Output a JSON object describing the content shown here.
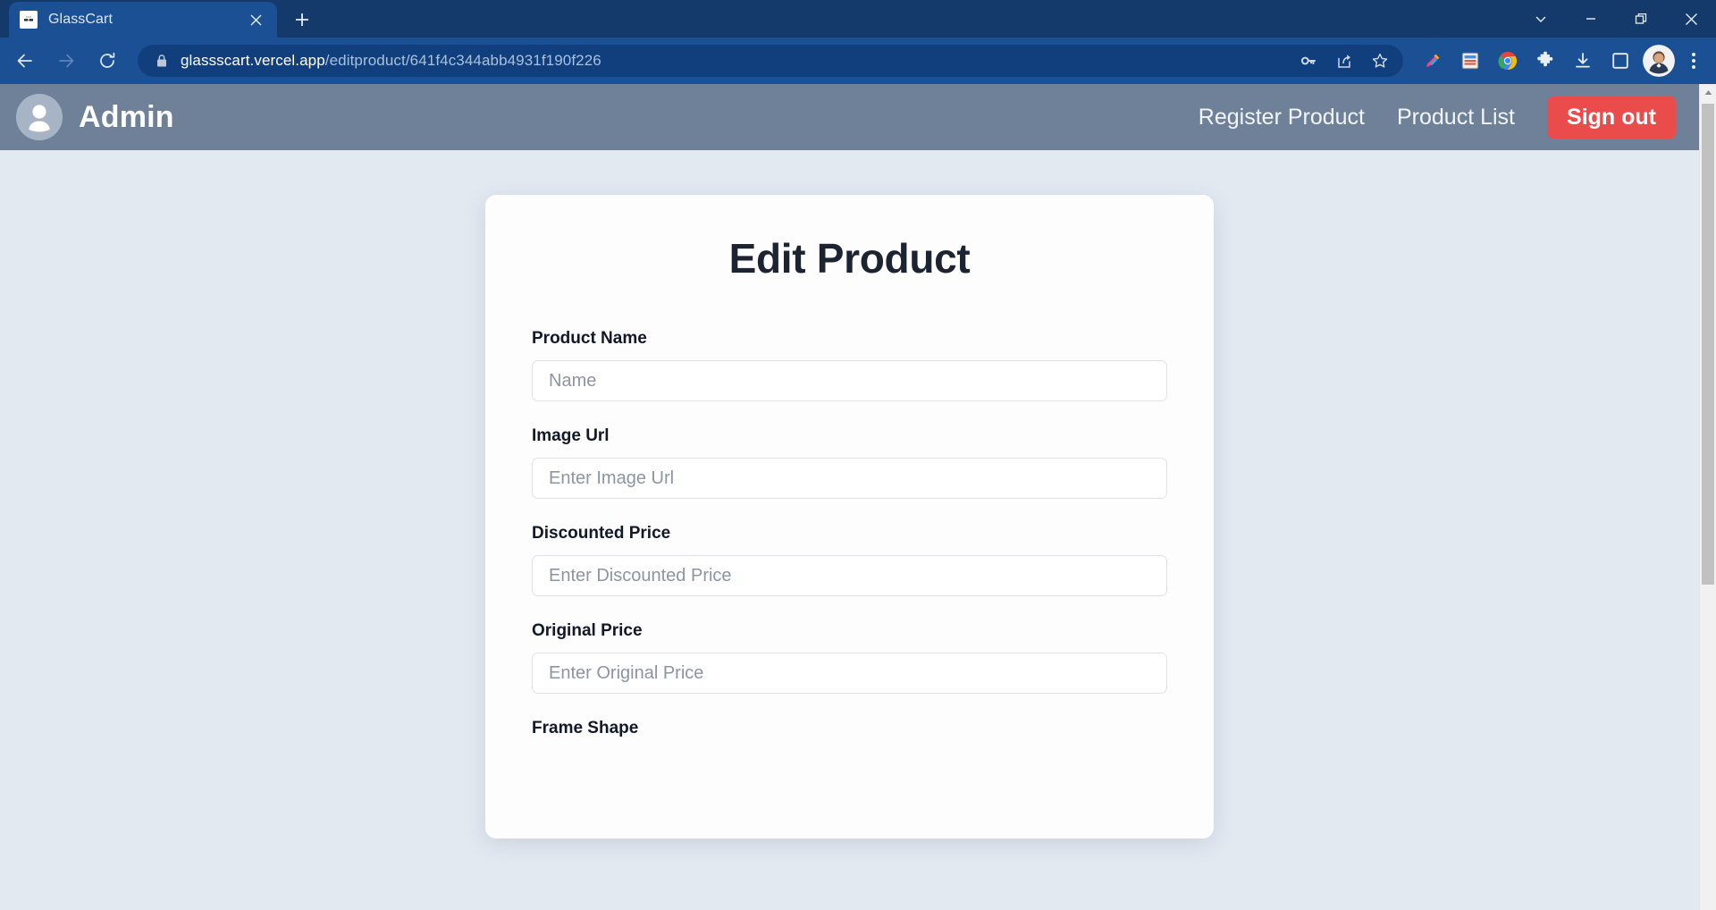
{
  "browser": {
    "tab": {
      "title": "GlassCart",
      "favicon_icon": "glasscart-favicon",
      "close_icon": "close-icon"
    },
    "new_tab_icon": "plus-icon",
    "window_controls": [
      {
        "name": "tab-search",
        "icon": "chevron-down-icon"
      },
      {
        "name": "minimize",
        "icon": "minimize-icon"
      },
      {
        "name": "maximize",
        "icon": "restore-icon"
      },
      {
        "name": "close",
        "icon": "close-icon"
      }
    ],
    "nav": {
      "back_icon": "arrow-left-icon",
      "forward_icon": "arrow-right-icon",
      "reload_icon": "reload-icon"
    },
    "omnibox": {
      "lock_icon": "lock-icon",
      "url_domain": "glassscart.vercel.app",
      "url_path": "/editproduct/641f4c344abb4931f190f226",
      "actions": [
        {
          "name": "password-manager",
          "icon": "key-icon"
        },
        {
          "name": "share",
          "icon": "share-icon"
        },
        {
          "name": "bookmark",
          "icon": "star-icon"
        }
      ]
    },
    "extensions": [
      {
        "name": "eyedropper-extension",
        "icon": "eyedropper-icon"
      },
      {
        "name": "reader-extension",
        "icon": "document-color-icon"
      },
      {
        "name": "chrome-extension",
        "icon": "chrome-icon"
      },
      {
        "name": "extensions-menu",
        "icon": "puzzle-icon"
      },
      {
        "name": "downloads",
        "icon": "download-icon"
      },
      {
        "name": "side-panel",
        "icon": "square-icon"
      }
    ],
    "profile": {
      "name": "profile-avatar",
      "icon": "user-photo-icon"
    },
    "menu_icon": "three-dots-icon"
  },
  "site": {
    "header": {
      "avatar_icon": "user-circle-icon",
      "brand": "Admin",
      "nav_links": [
        {
          "label": "Register Product"
        },
        {
          "label": "Product List"
        }
      ],
      "signout_label": "Sign out"
    },
    "card": {
      "title": "Edit Product",
      "fields": [
        {
          "label": "Product Name",
          "placeholder": "Name",
          "value": ""
        },
        {
          "label": "Image Url",
          "placeholder": "Enter Image Url",
          "value": ""
        },
        {
          "label": "Discounted Price",
          "placeholder": "Enter Discounted Price",
          "value": ""
        },
        {
          "label": "Original Price",
          "placeholder": "Enter Original Price",
          "value": ""
        },
        {
          "label": "Frame Shape",
          "placeholder": "",
          "value": ""
        }
      ]
    }
  },
  "colors": {
    "chrome_blue": "#1b5095",
    "tabstrip_blue": "#14396b",
    "site_header": "#6f8099",
    "page_background": "#e3e9f1",
    "signout_red": "#ea4b4b",
    "card_white": "#fdfdfe"
  },
  "scrollbar": {
    "up_arrow_icon": "scroll-up-arrow-icon"
  }
}
